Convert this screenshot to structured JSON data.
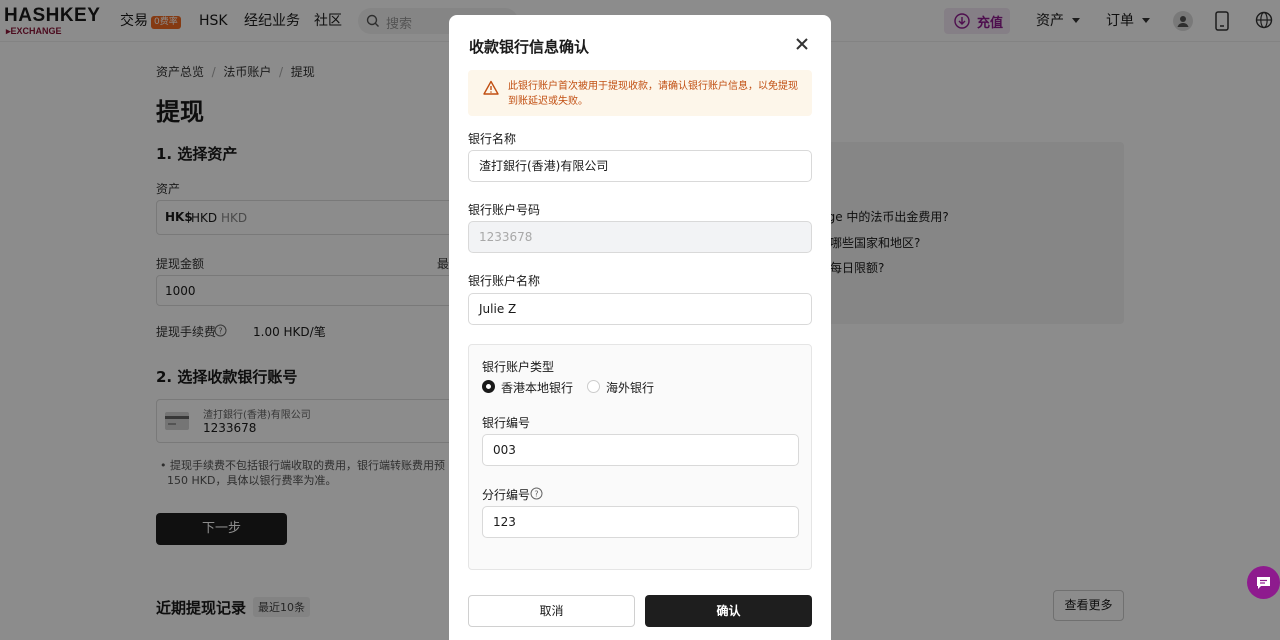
{
  "header": {
    "logo_main": "HASHKEY",
    "logo_sub": "EXCHANGE",
    "nav": [
      {
        "label": "交易",
        "badge": "0费率"
      },
      {
        "label": "HSK"
      },
      {
        "label": "经纪业务"
      },
      {
        "label": "社区"
      }
    ],
    "search_placeholder": "搜索",
    "deposit_label": "充值",
    "assets_label": "资产",
    "orders_label": "订单"
  },
  "breadcrumb": [
    "资产总览",
    "法币账户",
    "提现"
  ],
  "page": {
    "title": "提现",
    "step1": {
      "heading": "1. 选择资产",
      "asset_label": "资产",
      "asset_symbol": "HK$",
      "asset_code": "HKD",
      "asset_name": "HKD",
      "amount_label": "提现金额",
      "amount_right_label": "最",
      "amount_value": "1000",
      "fee_label": "提现手续费",
      "fee_value": "1.00 HKD/笔"
    },
    "step2": {
      "heading": "2. 选择收款银行账号",
      "bank_name": "渣打銀行(香港)有限公司",
      "account_number": "1233678",
      "note_line1": "提现手续费不包括银行端收取的费用，银行端转账费用预",
      "note_line2": "150 HKD，具体以银行费率为准。"
    },
    "next_label": "下一步",
    "recent": {
      "title": "近期提现记录",
      "badge": "最近10条",
      "view_more": "查看更多"
    },
    "faq": [
      "nge 中的法币出金费用?",
      "哪些国家和地区?",
      "每日限额?"
    ]
  },
  "modal": {
    "title": "收款银行信息确认",
    "warning": "此银行账户首次被用于提现收款，请确认银行账户信息，以免提现到账延迟或失败。",
    "bank_name_label": "银行名称",
    "bank_name_value": "渣打銀行(香港)有限公司",
    "account_no_label": "银行账户号码",
    "account_no_value": "1233678",
    "account_name_label": "银行账户名称",
    "account_name_value": "Julie Z",
    "account_type_label": "银行账户类型",
    "account_type_options": [
      "香港本地银行",
      "海外银行"
    ],
    "account_type_selected": "香港本地银行",
    "bank_code_label": "银行编号",
    "bank_code_value": "003",
    "branch_code_label": "分行编号",
    "branch_code_value": "123",
    "cancel_label": "取消",
    "confirm_label": "确认"
  },
  "colors": {
    "brand": "#8e1b8e",
    "warning_bg": "#fdf6ea",
    "warning_text": "#c14f12",
    "primary_button": "#1e1e1e",
    "badge": "#f26a21"
  },
  "icons": [
    "search-icon",
    "deposit-icon",
    "user-icon",
    "phone-icon",
    "globe-icon",
    "close-icon",
    "warning-icon",
    "help-icon",
    "bank-card-icon",
    "chat-icon"
  ]
}
